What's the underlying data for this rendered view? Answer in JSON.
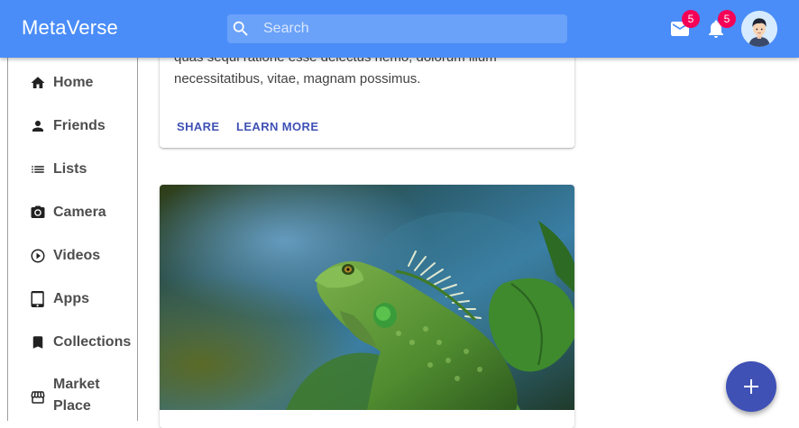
{
  "app": {
    "title": "MetaVerse"
  },
  "search": {
    "placeholder": "Search"
  },
  "header": {
    "mail_badge": "5",
    "notifications_badge": "5"
  },
  "sidebar": {
    "items": [
      {
        "label": "Home",
        "icon": "home-icon"
      },
      {
        "label": "Friends",
        "icon": "person-icon"
      },
      {
        "label": "Lists",
        "icon": "list-icon"
      },
      {
        "label": "Camera",
        "icon": "camera-icon"
      },
      {
        "label": "Videos",
        "icon": "play-circle-icon"
      },
      {
        "label": "Apps",
        "icon": "tablet-icon"
      },
      {
        "label": "Collections",
        "icon": "bookmark-icon"
      },
      {
        "label_line1": "Market",
        "label_line2": "Place",
        "icon": "storefront-icon"
      }
    ]
  },
  "feed": {
    "card1": {
      "text_line1": "quas sequi ratione esse delectus nemo, dolorum illum",
      "text_line2": "necessitatibus, vitae, magnam possimus.",
      "share_label": "SHARE",
      "learn_more_label": "LEARN MORE"
    }
  },
  "colors": {
    "appbar": "#4a8df8",
    "accent": "#3f51b5",
    "badge": "#f50057"
  }
}
